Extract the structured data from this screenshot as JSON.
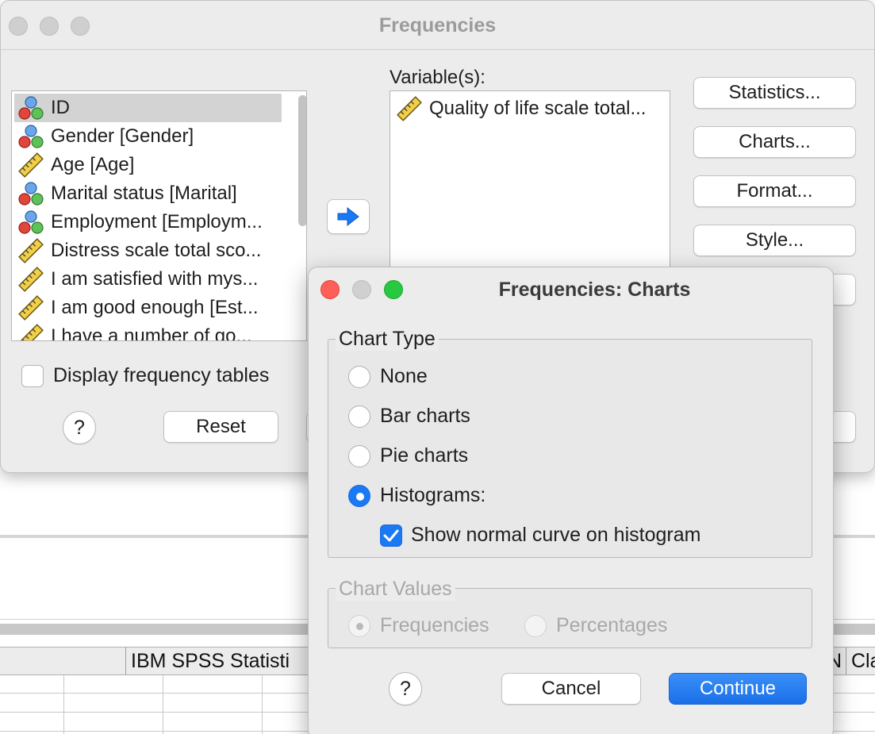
{
  "background": {
    "tabs": [
      "IBM SPSS Statisti",
      "N",
      "Cla"
    ]
  },
  "main_window": {
    "title": "Frequencies",
    "variables": [
      {
        "label": "ID",
        "icon": "nominal-icon",
        "selected": true
      },
      {
        "label": "Gender [Gender]",
        "icon": "nominal-icon"
      },
      {
        "label": "Age [Age]",
        "icon": "scale-ruler-icon"
      },
      {
        "label": "Marital status [Marital]",
        "icon": "nominal-icon"
      },
      {
        "label": "Employment [Employm...",
        "icon": "nominal-icon"
      },
      {
        "label": "Distress scale total sco...",
        "icon": "scale-ruler-icon"
      },
      {
        "label": "I am satisfied with mys...",
        "icon": "scale-ruler-icon"
      },
      {
        "label": "I am good enough [Est...",
        "icon": "scale-ruler-icon"
      },
      {
        "label": "I have a number of go...",
        "icon": "scale-ruler-icon"
      }
    ],
    "target_label": "Variable(s):",
    "target_items": [
      {
        "label": "Quality of life scale total...",
        "icon": "scale-ruler-icon"
      }
    ],
    "buttons": {
      "statistics": "Statistics...",
      "charts": "Charts...",
      "format": "Format...",
      "style": "Style..."
    },
    "display_freq_tables": {
      "label": "Display frequency tables",
      "checked": false
    },
    "help": "?",
    "reset": "Reset"
  },
  "charts_dialog": {
    "title": "Frequencies: Charts",
    "chart_type": {
      "title": "Chart Type",
      "options": [
        "None",
        "Bar charts",
        "Pie charts",
        "Histograms:"
      ],
      "selected": "Histograms:",
      "normal_curve": {
        "label": "Show normal curve on histogram",
        "checked": true
      }
    },
    "chart_values": {
      "title": "Chart Values",
      "options": [
        "Frequencies",
        "Percentages"
      ],
      "selected": "Frequencies",
      "disabled": true
    },
    "help": "?",
    "cancel": "Cancel",
    "continue": "Continue"
  },
  "colors": {
    "accent": "#1a79f4",
    "window_bg": "#ececec",
    "traffic_red": "#ff5f57",
    "traffic_green": "#28c840"
  }
}
